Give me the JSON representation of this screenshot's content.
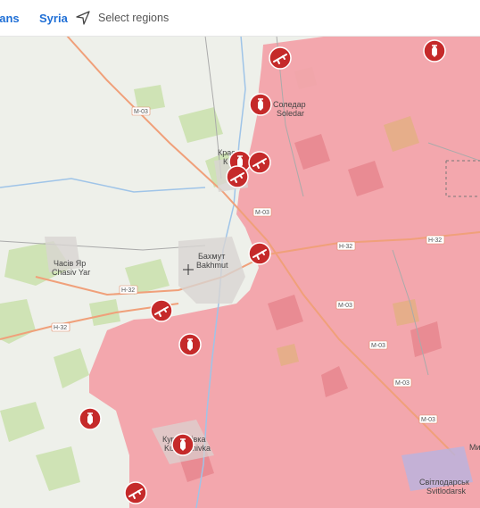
{
  "topbar": {
    "tab_partial": "kans",
    "tab_syria": "Syria",
    "select_regions": "Select regions",
    "nav_icon": "navigation-arrow-icon"
  },
  "map": {
    "colors": {
      "occupied": "#f2a2aa",
      "base": "#eef0ea",
      "road": "#f0a07a",
      "marker": "#c52a2a"
    },
    "places": {
      "soledar_uk": "Соледар",
      "soledar_en": "Soledar",
      "krasna_uk": "Крас",
      "krasna_en": "К",
      "bakhmut_uk": "Бахмут",
      "bakhmut_en": "Bakhmut",
      "chasiv_uk": "Часів Яр",
      "chasiv_en": "Chasiv Yar",
      "kurdyumivka_uk": "Курдюмівка",
      "kurdyumivka_en": "Kurdyumivka",
      "svitlodarsk_uk": "Світлодарськ",
      "svitlodarsk_en": "Svitlodarsk",
      "myr_partial": "Ми"
    },
    "roads": {
      "m03": "M-03",
      "h32": "H-32"
    },
    "markers": [
      {
        "id": "m1",
        "kind": "gun-icon"
      },
      {
        "id": "m2",
        "kind": "bomb-icon"
      },
      {
        "id": "m3",
        "kind": "bomb-icon"
      },
      {
        "id": "m4",
        "kind": "bomb-icon"
      },
      {
        "id": "m5",
        "kind": "gun-icon"
      },
      {
        "id": "m6",
        "kind": "gun-icon"
      },
      {
        "id": "m7",
        "kind": "gun-icon"
      },
      {
        "id": "m8",
        "kind": "gun-icon"
      },
      {
        "id": "m9",
        "kind": "bomb-icon"
      },
      {
        "id": "m10",
        "kind": "bomb-icon"
      },
      {
        "id": "m11",
        "kind": "bomb-icon"
      },
      {
        "id": "m12",
        "kind": "gun-icon"
      }
    ]
  }
}
